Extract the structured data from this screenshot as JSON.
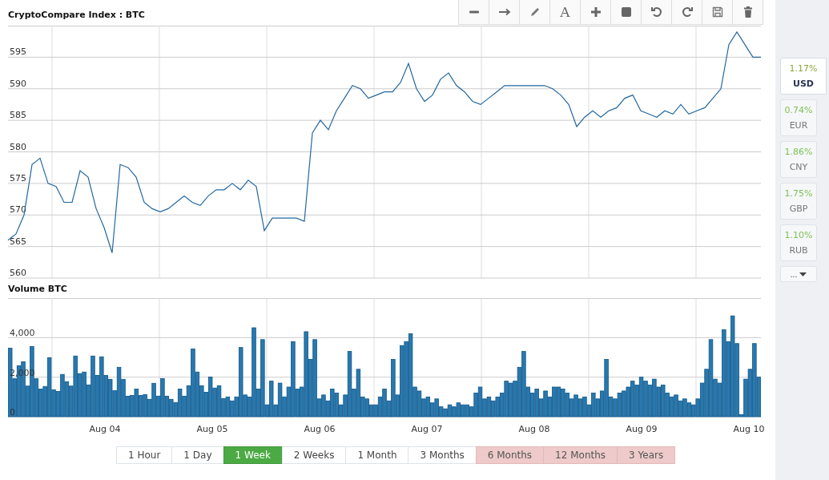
{
  "title": "CryptoCompare Index : BTC",
  "toolbar": [
    {
      "kind": "minus"
    },
    {
      "kind": "arrow"
    },
    {
      "kind": "pencil"
    },
    {
      "kind": "text",
      "label": "A"
    },
    {
      "kind": "plus"
    },
    {
      "kind": "square"
    },
    {
      "kind": "undo"
    },
    {
      "kind": "redo"
    },
    {
      "kind": "save"
    },
    {
      "kind": "trash"
    }
  ],
  "price_chart": {
    "chart_data": {
      "type": "line",
      "grid": true,
      "ylim": [
        560,
        600
      ],
      "yticks": [
        560,
        565,
        570,
        575,
        580,
        585,
        590,
        595
      ],
      "series": [
        {
          "color": "#2467a0",
          "values": [
            566,
            567,
            570,
            578,
            579,
            575,
            574.5,
            572,
            572,
            577,
            576,
            571,
            568,
            564,
            578,
            577.5,
            576,
            572,
            571,
            570.5,
            571,
            572,
            573,
            572,
            571.5,
            573,
            574,
            574,
            575,
            574,
            575.5,
            574.5,
            567.5,
            569.5,
            569.5,
            569.5,
            569.5,
            569,
            583,
            585,
            583.5,
            586.5,
            588.5,
            590.5,
            590,
            588.5,
            589,
            589.5,
            589.5,
            591,
            594,
            590,
            588,
            589,
            591.5,
            592.5,
            590.5,
            589.5,
            588,
            587.5,
            588.5,
            589.5,
            590.5,
            590.5,
            590.5,
            590.5,
            590.5,
            590.5,
            590,
            589,
            587.5,
            584,
            585.5,
            586.5,
            585.5,
            586.5,
            587,
            588.5,
            589,
            586.5,
            586,
            585.5,
            586.5,
            586,
            587.5,
            586,
            586.5,
            587,
            588.5,
            590,
            597,
            599,
            597,
            595,
            595
          ]
        }
      ]
    }
  },
  "volume_chart": {
    "date_labels": [
      "Aug 04",
      "Aug 05",
      "Aug 06",
      "Aug 07",
      "Aug 08",
      "Aug 09",
      "Aug 10"
    ],
    "chart_data": {
      "type": "bar",
      "title": "Volume BTC",
      "grid": true,
      "ylim": [
        0,
        6000
      ],
      "yticks": [
        {
          "value": 0,
          "label": "0"
        },
        {
          "value": 2000,
          "label": "2,000"
        },
        {
          "value": 4000,
          "label": "4,000"
        }
      ],
      "series": [
        {
          "color": "#2a78ad",
          "values": [
            3470,
            1920,
            2580,
            2780,
            1550,
            3550,
            1920,
            1400,
            1530,
            2990,
            1360,
            1280,
            2140,
            1770,
            1550,
            3070,
            2180,
            2260,
            1610,
            3070,
            2090,
            3030,
            2090,
            1890,
            1320,
            2500,
            1890,
            1040,
            1080,
            1400,
            1080,
            1120,
            880,
            1690,
            1040,
            1930,
            1040,
            880,
            720,
            1400,
            1040,
            1570,
            3430,
            2260,
            1570,
            1240,
            2010,
            1450,
            1570,
            920,
            1000,
            800,
            1000,
            3500,
            1100,
            1000,
            4500,
            1400,
            3900,
            600,
            1800,
            600,
            1700,
            1000,
            1500,
            3800,
            1400,
            1500,
            4300,
            2900,
            3900,
            900,
            1100,
            800,
            1400,
            1200,
            600,
            1100,
            3300,
            1400,
            2400,
            1000,
            900,
            600,
            600,
            1000,
            1400,
            800,
            2900,
            1100,
            3600,
            3800,
            4200,
            1500,
            1300,
            900,
            1000,
            700,
            900,
            500,
            400,
            600,
            500,
            700,
            600,
            600,
            500,
            1200,
            1500,
            900,
            1000,
            800,
            1000,
            1200,
            1800,
            1700,
            1800,
            2500,
            3300,
            1500,
            1200,
            1400,
            900,
            1300,
            1000,
            1500,
            1500,
            1400,
            1200,
            900,
            1100,
            900,
            1000,
            600,
            1200,
            900,
            1300,
            2900,
            1000,
            900,
            1200,
            1300,
            1500,
            1800,
            1600,
            2000,
            1800,
            1600,
            1900,
            1500,
            1600,
            1200,
            1000,
            1100,
            800,
            900,
            700,
            600,
            900,
            1700,
            2400,
            3900,
            1900,
            1700,
            4400,
            3800,
            5100,
            3700,
            100,
            1900,
            2400,
            3700,
            2000
          ]
        }
      ]
    }
  },
  "ranges": [
    {
      "label": "1 Hour",
      "selected": false,
      "locked": false
    },
    {
      "label": "1 Day",
      "selected": false,
      "locked": false
    },
    {
      "label": "1 Week",
      "selected": true,
      "locked": false
    },
    {
      "label": "2 Weeks",
      "selected": false,
      "locked": false
    },
    {
      "label": "1 Month",
      "selected": false,
      "locked": false
    },
    {
      "label": "3 Months",
      "selected": false,
      "locked": false
    },
    {
      "label": "6 Months",
      "selected": false,
      "locked": true
    },
    {
      "label": "12 Months",
      "selected": false,
      "locked": true
    },
    {
      "label": "3 Years",
      "selected": false,
      "locked": true
    }
  ],
  "currencies": [
    {
      "change": "1.17%",
      "code": "USD",
      "selected": true
    },
    {
      "change": "0.74%",
      "code": "EUR",
      "selected": false
    },
    {
      "change": "1.86%",
      "code": "CNY",
      "selected": false
    },
    {
      "change": "1.75%",
      "code": "GBP",
      "selected": false
    },
    {
      "change": "1.10%",
      "code": "RUB",
      "selected": false
    }
  ],
  "more": {
    "label": "..."
  }
}
